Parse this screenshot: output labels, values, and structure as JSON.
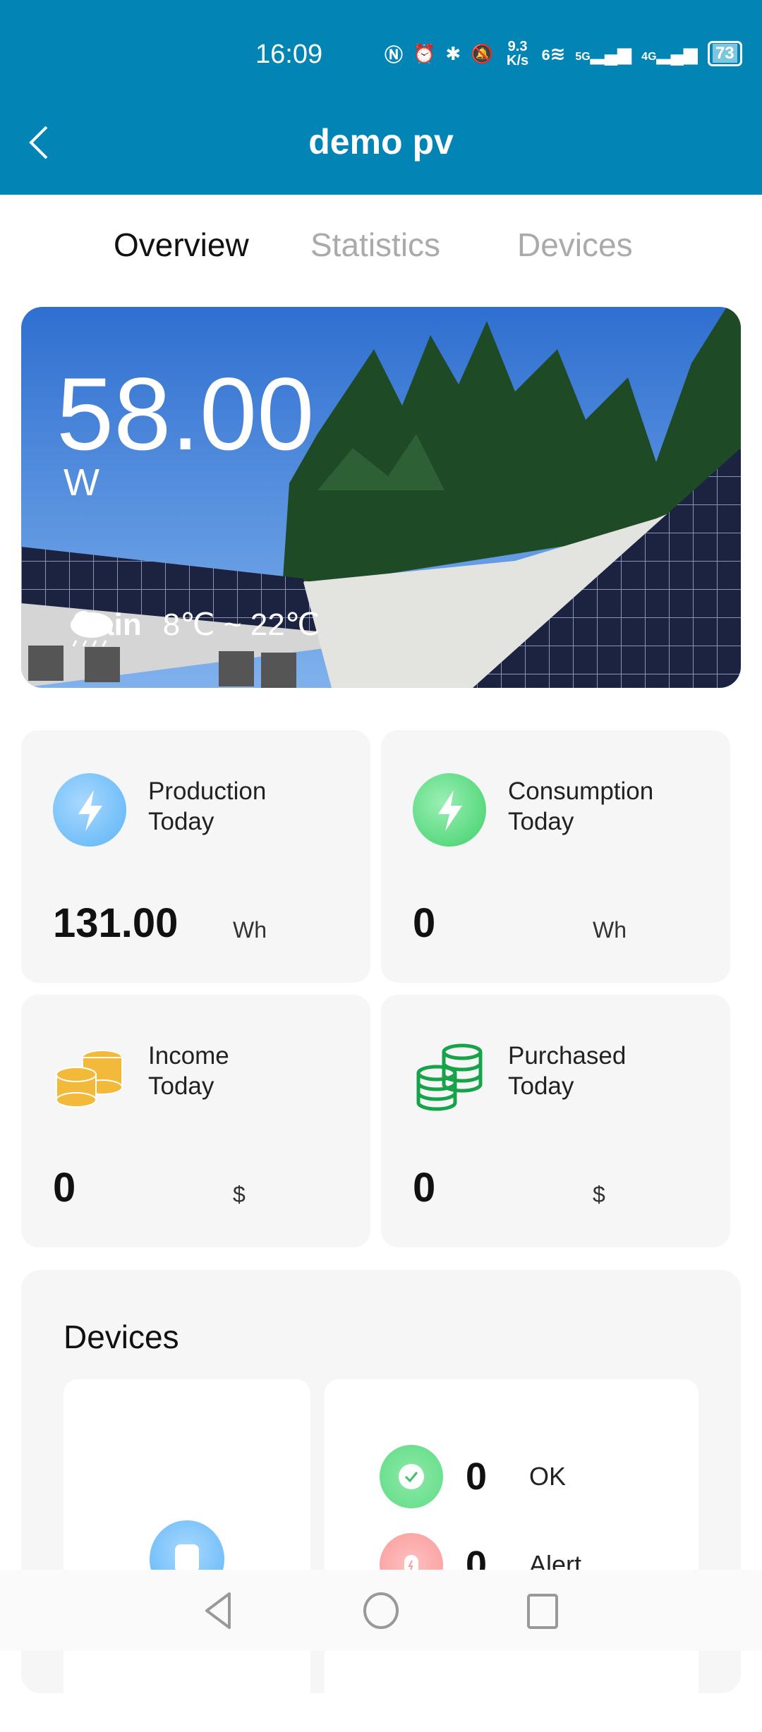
{
  "status_bar": {
    "time": "16:09",
    "speed": "9.3 K/s",
    "wifi": "6",
    "net1": "5G",
    "net2": "4G",
    "battery": "73",
    "icons": [
      "nfc-icon",
      "alarm-icon",
      "bluetooth-icon",
      "bell-off-icon",
      "wifi-icon",
      "signal-icon",
      "battery-icon"
    ]
  },
  "header": {
    "title": "demo pv",
    "back_icon": "chevron-left-icon"
  },
  "tabs": [
    {
      "label": "Overview",
      "active": true
    },
    {
      "label": "Statistics",
      "active": false
    },
    {
      "label": "Devices",
      "active": false
    }
  ],
  "hero": {
    "power": "58.00",
    "unit": "W",
    "weather": "rain",
    "temp_range": "8℃ ~ 22℃",
    "weather_icon": "rain-cloud-icon"
  },
  "stats": [
    {
      "label1": "Production",
      "label2": "Today",
      "value": "131.00",
      "unit": "Wh",
      "icon": "lightning-icon",
      "color": "#5ab4f6"
    },
    {
      "label1": "Consumption",
      "label2": "Today",
      "value": "0",
      "unit": "Wh",
      "icon": "lightning-icon",
      "color": "#3fd06a"
    },
    {
      "label1": "Income",
      "label2": "Today",
      "value": "0",
      "unit": "$",
      "icon": "coins-icon",
      "color": "#f2b93b"
    },
    {
      "label1": "Purchased",
      "label2": "Today",
      "value": "0",
      "unit": "$",
      "icon": "cash-stack-icon",
      "color": "#16a34a"
    }
  ],
  "devices": {
    "title": "Devices",
    "ok_count": "0",
    "ok_label": "OK",
    "alert_count": "0",
    "alert_label": "Alert",
    "ok_color": "#5fdc84",
    "alert_color": "#fa9c9c"
  },
  "nav": [
    "back-icon",
    "home-icon",
    "recents-icon"
  ]
}
